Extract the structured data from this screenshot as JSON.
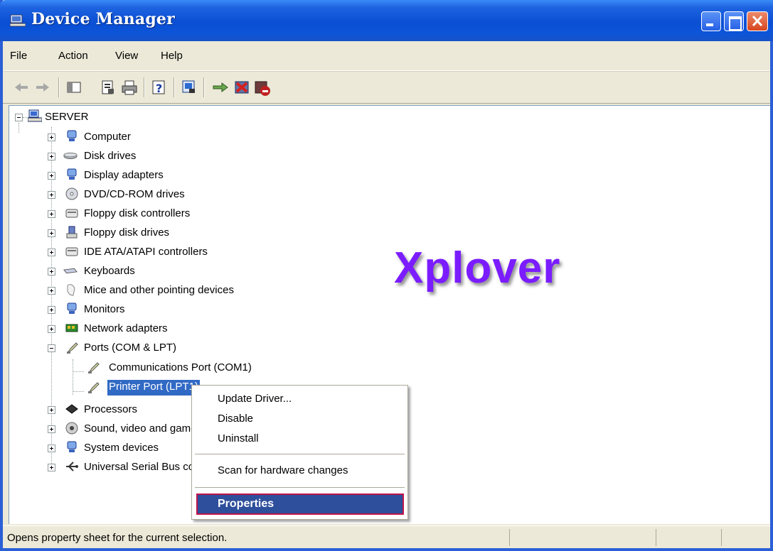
{
  "window": {
    "title": "Device Manager"
  },
  "menu": {
    "items": [
      "File",
      "Action",
      "View",
      "Help"
    ]
  },
  "toolbar": {
    "buttons": [
      "back-arrow-icon",
      "forward-arrow-icon",
      "show-hide-console-tree-icon",
      "properties-icon",
      "print-icon",
      "help-icon",
      "scan-hardware-icon",
      "update-driver-icon",
      "uninstall-icon",
      "disable-icon"
    ]
  },
  "tree": {
    "root": "SERVER",
    "items": [
      {
        "label": "Computer",
        "icon": "computer-icon"
      },
      {
        "label": "Disk drives",
        "icon": "disk-drive-icon"
      },
      {
        "label": "Display adapters",
        "icon": "display-adapter-icon"
      },
      {
        "label": "DVD/CD-ROM drives",
        "icon": "cdrom-icon"
      },
      {
        "label": "Floppy disk controllers",
        "icon": "floppy-controller-icon"
      },
      {
        "label": "Floppy disk drives",
        "icon": "floppy-drive-icon"
      },
      {
        "label": "IDE ATA/ATAPI controllers",
        "icon": "ide-controller-icon"
      },
      {
        "label": "Keyboards",
        "icon": "keyboard-icon"
      },
      {
        "label": "Mice and other pointing devices",
        "icon": "mouse-icon"
      },
      {
        "label": "Monitors",
        "icon": "monitor-icon"
      },
      {
        "label": "Network adapters",
        "icon": "network-adapter-icon"
      },
      {
        "label": "Ports (COM & LPT)",
        "icon": "port-icon"
      },
      {
        "label": "Processors",
        "icon": "processor-icon"
      },
      {
        "label": "Sound, video and game controllers",
        "icon": "sound-icon"
      },
      {
        "label": "System devices",
        "icon": "system-device-icon"
      },
      {
        "label": "Universal Serial Bus controllers",
        "icon": "usb-icon"
      }
    ],
    "ports_children": [
      "Communications Port (COM1)",
      "Printer Port (LPT1)"
    ]
  },
  "context_menu": {
    "update_driver": "Update Driver...",
    "disable": "Disable",
    "uninstall": "Uninstall",
    "scan": "Scan for hardware changes",
    "properties": "Properties"
  },
  "watermark": "Xplover",
  "status": {
    "text": "Opens property sheet for the current selection."
  },
  "colors": {
    "selection": "#316ac5",
    "titlebar": "#0a4fd4",
    "watermark": "#7b1cff",
    "highlight_border": "#c0164a"
  }
}
